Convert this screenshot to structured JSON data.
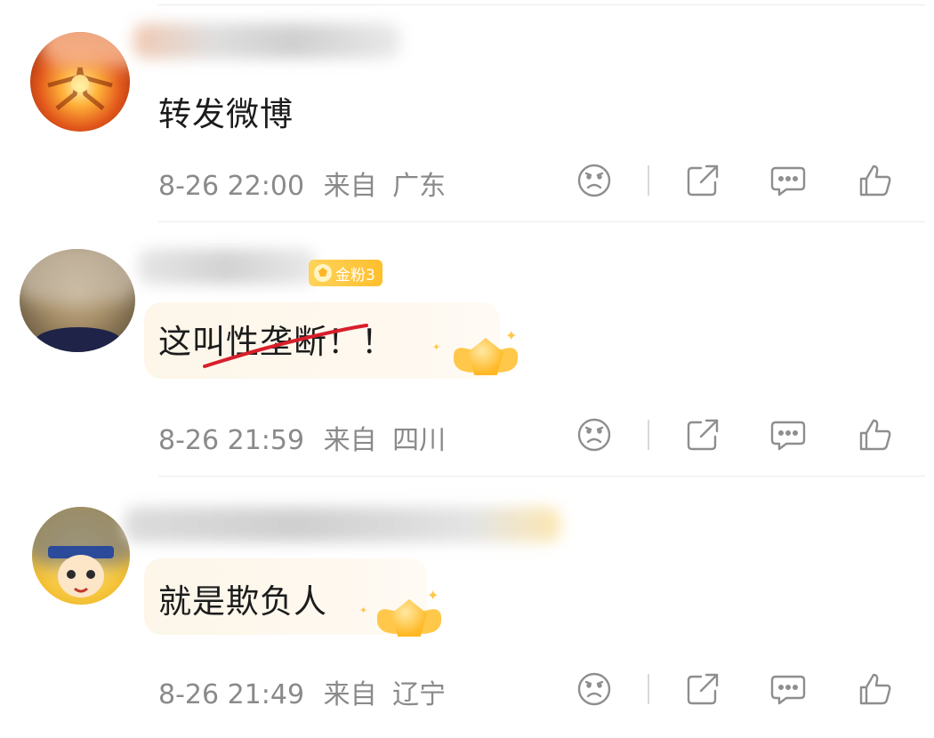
{
  "comments": [
    {
      "text": "转发微博",
      "time": "8-26 22:00",
      "from_label": "来自",
      "location": "广东",
      "has_badge": false,
      "has_medal": false,
      "username_blurred": true
    },
    {
      "text": "这叫性垄断！！",
      "time": "8-26 21:59",
      "from_label": "来自",
      "location": "四川",
      "badge_label": "金粉3",
      "has_badge": true,
      "has_medal": true,
      "username_blurred": true
    },
    {
      "text": "就是欺负人",
      "time": "8-26 21:49",
      "from_label": "来自",
      "location": "辽宁",
      "has_badge": false,
      "has_medal": true,
      "username_blurred": true
    }
  ],
  "icons": {
    "dislike": "sad-face-icon",
    "share": "share-icon",
    "reply": "comment-icon",
    "like": "thumbs-up-icon"
  },
  "colors": {
    "badge": "#ffc12e",
    "strikethrough": "#d81e2b",
    "meta_text": "#8a8a8a",
    "icon": "#8e8e8e"
  }
}
